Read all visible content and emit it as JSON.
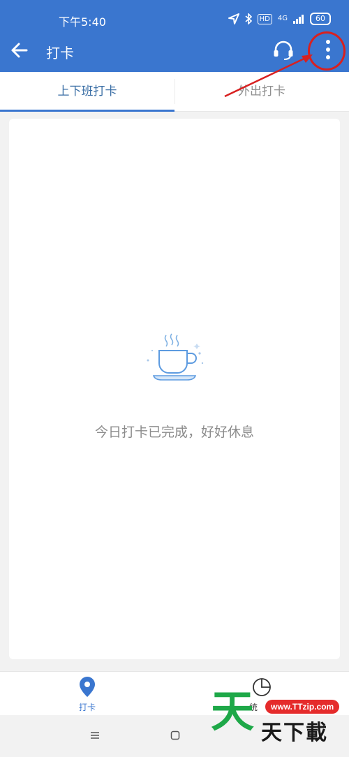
{
  "status_bar": {
    "time": "下午5:40",
    "hd": "HD",
    "network": "4G",
    "battery": "60"
  },
  "app_bar": {
    "title": "打卡"
  },
  "tabs": [
    {
      "label": "上下班打卡",
      "active": true
    },
    {
      "label": "外出打卡",
      "active": false
    }
  ],
  "content": {
    "empty_message": "今日打卡已完成，好好休息"
  },
  "bottom_nav": [
    {
      "label": "打卡",
      "icon": "location-pin-icon",
      "active": true
    },
    {
      "label": "统",
      "icon": "pie-chart-icon",
      "active": false
    }
  ],
  "watermark": {
    "logo_char": "天",
    "url": "www.TTzip.com",
    "text": "天下載"
  },
  "colors": {
    "primary": "#3a76cf",
    "annotation": "#d82020",
    "watermark_green": "#1ea848"
  }
}
